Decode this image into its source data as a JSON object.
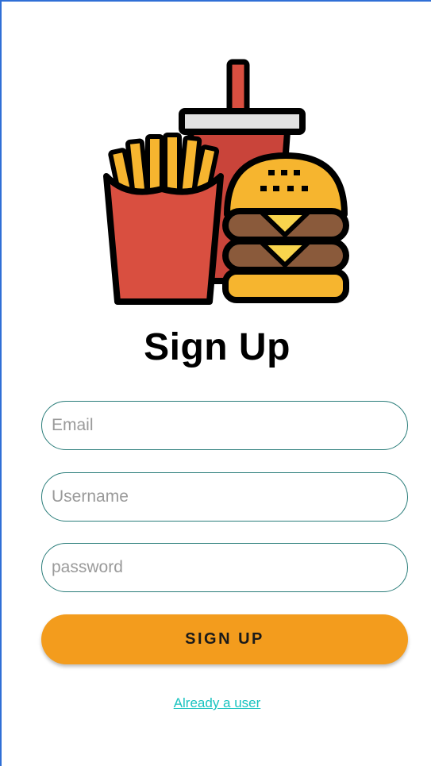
{
  "logo": {
    "icon": "fast-food-icon"
  },
  "title": "Sign Up",
  "form": {
    "email_placeholder": "Email",
    "username_placeholder": "Username",
    "password_placeholder": "password",
    "submit_label": "SIGN UP"
  },
  "login_link": "Already a user",
  "colors": {
    "accent": "#f39c1d",
    "field_border": "#2a7d7a",
    "link": "#19c3c0",
    "window_border": "#2f6fd6"
  }
}
